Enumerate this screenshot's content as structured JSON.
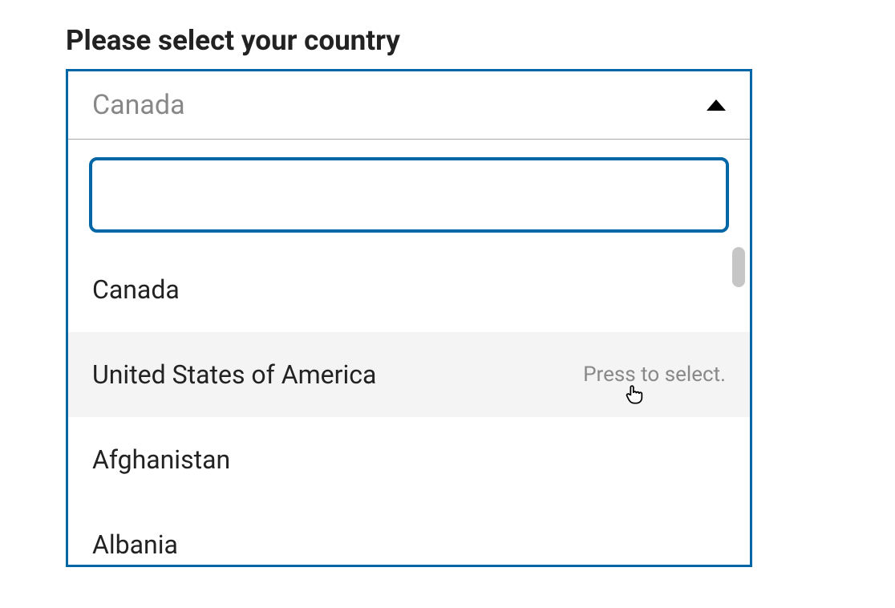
{
  "label": "Please select your country",
  "dropdown": {
    "selected": "Canada",
    "search_value": "",
    "hint": "Press to select.",
    "options": [
      {
        "name": "Canada",
        "highlighted": false
      },
      {
        "name": "United States of America",
        "highlighted": true
      },
      {
        "name": "Afghanistan",
        "highlighted": false
      },
      {
        "name": "Albania",
        "highlighted": false
      }
    ]
  }
}
